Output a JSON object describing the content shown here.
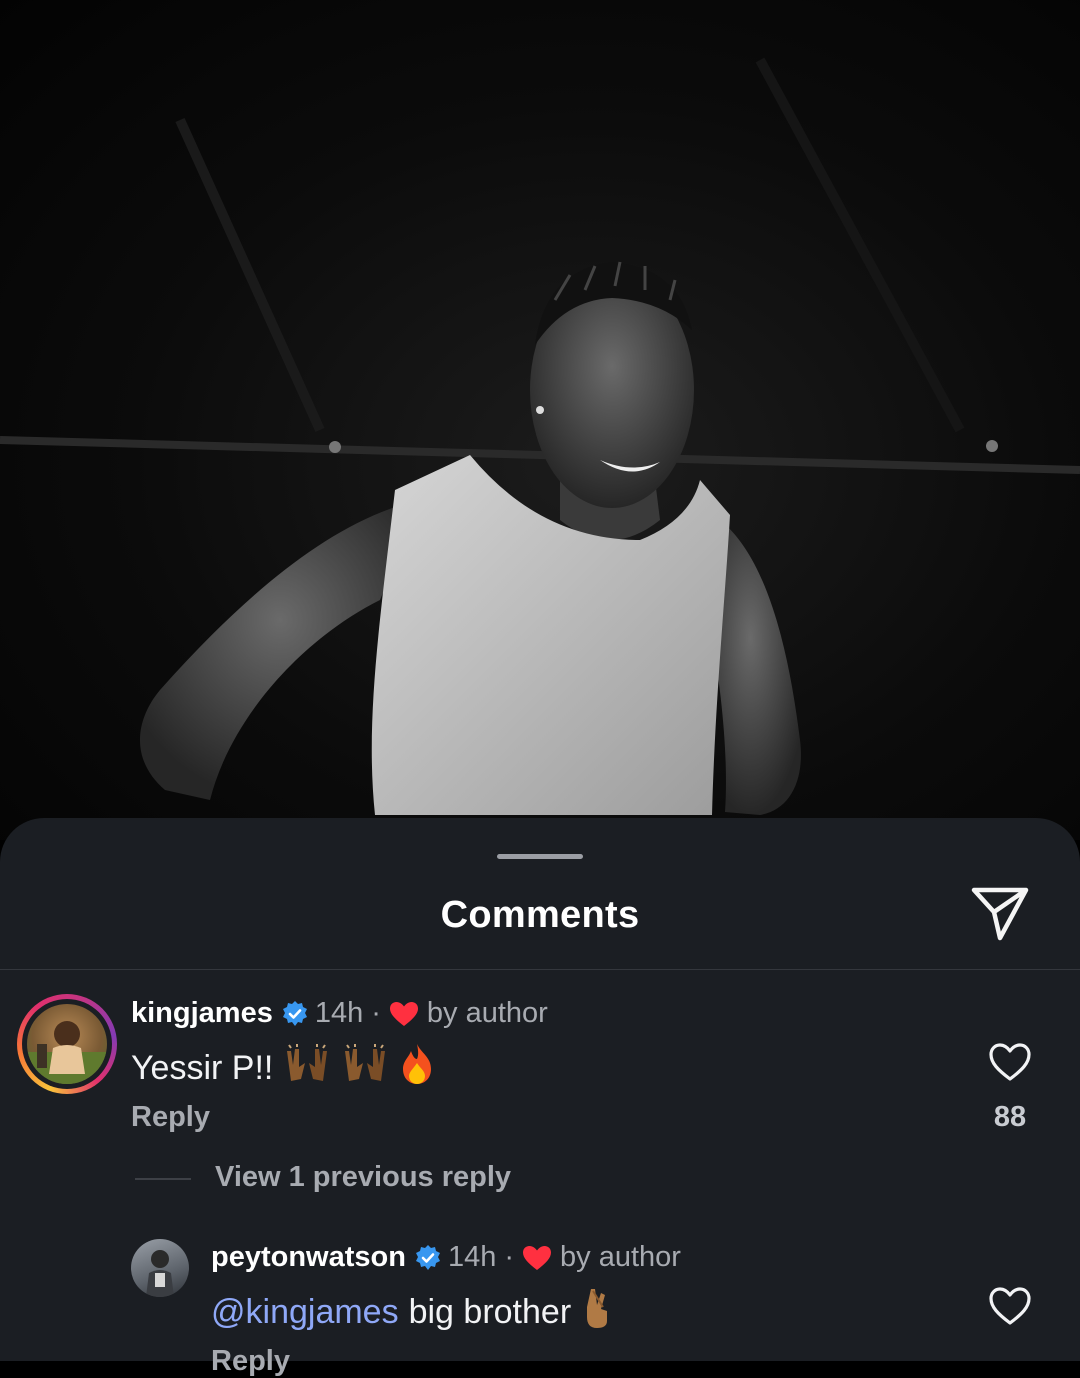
{
  "sheet": {
    "title": "Comments",
    "share_icon": "paper-plane-icon"
  },
  "comments": [
    {
      "username": "kingjames",
      "verified": true,
      "time": "14h",
      "separator": "·",
      "liked_by_author_label": "by author",
      "text": "Yessir P!!",
      "emoji": [
        "raising-hands-dark-skin",
        "raising-hands-dark-skin",
        "fire"
      ],
      "reply_label": "Reply",
      "like_count": "88"
    }
  ],
  "thread": {
    "view_replies_label": "View 1 previous reply"
  },
  "replies": [
    {
      "username": "peytonwatson",
      "verified": true,
      "time": "14h",
      "separator": "·",
      "liked_by_author_label": "by author",
      "mention": "@kingjames",
      "text": "big brother",
      "emoji": [
        "crossed-fingers-medium-skin"
      ],
      "reply_label": "Reply"
    }
  ],
  "colors": {
    "sheet_bg": "#1b1e23",
    "verified_blue": "#3897f0",
    "heart_red": "#ff3040",
    "mention": "#8fa8f7",
    "muted_text": "#a8abb1"
  }
}
